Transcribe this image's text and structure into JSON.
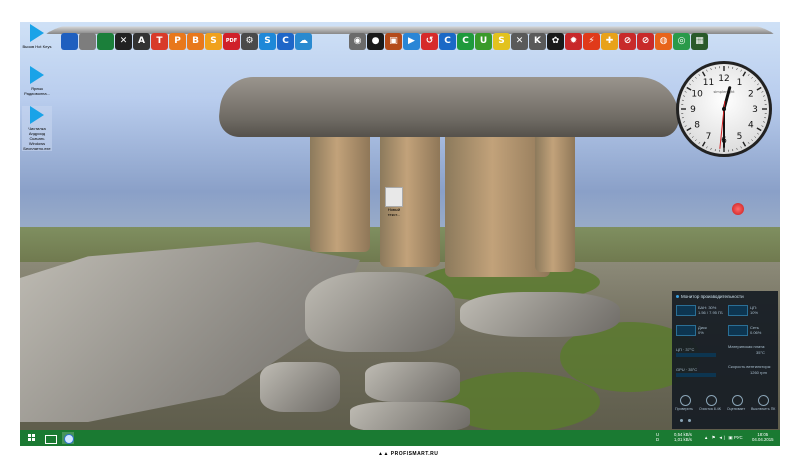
{
  "desktop_icons": [
    {
      "label": "Вызов Hot Keys",
      "icon": "play-icon"
    },
    {
      "label": "Ярлык Радиоволна...",
      "icon": "play-icon"
    },
    {
      "label": "Чистилка Андроид Скачать Windows Бесплатно.exe",
      "icon": "play-icon"
    }
  ],
  "dock_left": [
    {
      "icon": "monitor-icon",
      "color": "#1e5fbf",
      "text": ""
    },
    {
      "icon": "gear-icon",
      "color": "#7d7d7d",
      "text": ""
    },
    {
      "icon": "globe-icon",
      "color": "#1b7f3a",
      "text": ""
    },
    {
      "icon": "tools-icon",
      "color": "#222222",
      "text": "✕"
    },
    {
      "icon": "avast-icon",
      "color": "#333333",
      "text": "A"
    },
    {
      "icon": "t-icon",
      "color": "#d83a2a",
      "text": "T"
    },
    {
      "icon": "p-icon",
      "color": "#e8781c",
      "text": "P"
    },
    {
      "icon": "b-icon",
      "color": "#e8781c",
      "text": "B"
    },
    {
      "icon": "s-icon",
      "color": "#f0a11c",
      "text": "S"
    },
    {
      "icon": "pdf-icon",
      "color": "#d0202a",
      "text": "PDF"
    },
    {
      "icon": "settings-icon",
      "color": "#4a4a4a",
      "text": "⚙"
    },
    {
      "icon": "skype-icon",
      "color": "#1e88d8",
      "text": "S"
    },
    {
      "icon": "cc-icon",
      "color": "#1e66c8",
      "text": "C"
    },
    {
      "icon": "cloud-icon",
      "color": "#2a8ad0",
      "text": "☁"
    }
  ],
  "dock_right": [
    {
      "icon": "camera-icon",
      "color": "#6b6b6b",
      "text": "◉"
    },
    {
      "icon": "record-icon",
      "color": "#1a1a1a",
      "text": "●"
    },
    {
      "icon": "cube-icon",
      "color": "#b44b1a",
      "text": "▣"
    },
    {
      "icon": "play-icon",
      "color": "#2a86d6",
      "text": "▶"
    },
    {
      "icon": "arrow-icon",
      "color": "#d62a2a",
      "text": "↺"
    },
    {
      "icon": "c-blue-icon",
      "color": "#1b69c6",
      "text": "C"
    },
    {
      "icon": "c-green-icon",
      "color": "#1e9a3c",
      "text": "C"
    },
    {
      "icon": "u-icon",
      "color": "#3a9a2a",
      "text": "U"
    },
    {
      "icon": "s-yellow-icon",
      "color": "#e2c21e",
      "text": "S"
    },
    {
      "icon": "x-icon",
      "color": "#5a5a5a",
      "text": "✕"
    },
    {
      "icon": "bookmark-icon",
      "color": "#5a5a5a",
      "text": "K"
    },
    {
      "icon": "cat-icon",
      "color": "#1a1a1a",
      "text": "✿"
    },
    {
      "icon": "gear-red-icon",
      "color": "#c8282a",
      "text": "✹"
    },
    {
      "icon": "flash-icon",
      "color": "#e03a1a",
      "text": "⚡"
    },
    {
      "icon": "puzzle-icon",
      "color": "#e8a21a",
      "text": "✚"
    },
    {
      "icon": "no-icon",
      "color": "#c82a2a",
      "text": "⊘"
    },
    {
      "icon": "no2-icon",
      "color": "#c82a2a",
      "text": "⊘"
    },
    {
      "icon": "firefox-icon",
      "color": "#e8641a",
      "text": "◍"
    },
    {
      "icon": "chrome-icon",
      "color": "#2a9a4a",
      "text": "◎"
    },
    {
      "icon": "window-icon",
      "color": "#2a5a2a",
      "text": "▦"
    }
  ],
  "clock": {
    "brand": "simplenight",
    "hour": 12,
    "minute": 30,
    "second": 31
  },
  "file_icon": {
    "label": "Новый текст..."
  },
  "perf_monitor": {
    "title": "Монитор производительности",
    "ram_label": "БАН: 30%",
    "ram_detail": "1.56 / 7.95 ГБ",
    "cpu_label": "ЦП:",
    "cpu_value": "10%",
    "disk_label": "Диск",
    "disk_value": "0%",
    "net_label": "Сеть",
    "net_value": "0.06%",
    "cpu_temp_label": "ЦП · 37°C",
    "board_temp_label": "Материнская плата:",
    "board_temp_value": "35°C",
    "gpu_temp_label": "GPU · 35°C",
    "fan_label": "Скорость вентилятора:",
    "fan_value": "1260 rpm",
    "buttons": [
      "Проверить",
      "Очистка 8.4K",
      "Оценивает",
      "Выключить ПК"
    ]
  },
  "taskbar": {
    "upload": "0,54 kB/s",
    "download": "1,01 kB/s",
    "lang": "РУС",
    "time": "18:05",
    "date": "04.04.2015"
  },
  "watermark": "PROFISMART.RU"
}
